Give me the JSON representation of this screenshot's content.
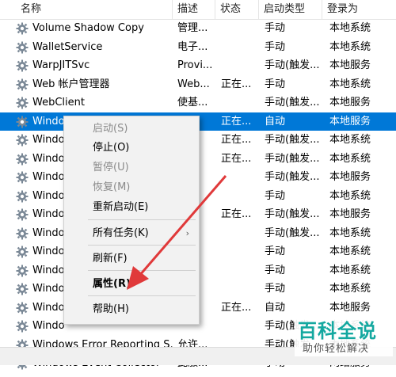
{
  "columns": {
    "name": "名称",
    "desc": "描述",
    "status": "状态",
    "type": "启动类型",
    "logon": "登录为"
  },
  "rows": [
    {
      "name": "Volume Shadow Copy",
      "desc": "管理...",
      "status": "",
      "type": "手动",
      "logon": "本地系统"
    },
    {
      "name": "WalletService",
      "desc": "电子...",
      "status": "",
      "type": "手动",
      "logon": "本地系统"
    },
    {
      "name": "WarpJITSvc",
      "desc": "Provi...",
      "status": "",
      "type": "手动(触发...",
      "logon": "本地服务"
    },
    {
      "name": "Web 帐户管理器",
      "desc": "Web...",
      "status": "正在...",
      "type": "手动",
      "logon": "本地系统"
    },
    {
      "name": "WebClient",
      "desc": "使基...",
      "status": "",
      "type": "手动(触发...",
      "logon": "本地服务"
    },
    {
      "name": "Windo",
      "desc": "...",
      "status": "正在...",
      "type": "自动",
      "logon": "本地服务",
      "selected": true
    },
    {
      "name": "Windo",
      "desc": "",
      "status": "正在...",
      "type": "手动(触发...",
      "logon": "本地系统"
    },
    {
      "name": "Windo",
      "desc": "",
      "status": "正在...",
      "type": "手动(触发...",
      "logon": "本地系统"
    },
    {
      "name": "Windo",
      "desc": "",
      "status": "",
      "type": "手动(触发...",
      "logon": "本地服务"
    },
    {
      "name": "Windo",
      "desc": "",
      "status": "",
      "type": "手动",
      "logon": "本地系统"
    },
    {
      "name": "Windo",
      "desc": "",
      "status": "正在...",
      "type": "手动(触发...",
      "logon": "本地服务"
    },
    {
      "name": "Windo",
      "desc": "",
      "status": "",
      "type": "手动(触发...",
      "logon": "本地系统"
    },
    {
      "name": "Windo",
      "desc": "",
      "status": "",
      "type": "手动",
      "logon": "本地系统"
    },
    {
      "name": "Windo",
      "desc": "",
      "status": "",
      "type": "手动",
      "logon": "本地系统"
    },
    {
      "name": "Windo",
      "desc": "",
      "status": "",
      "type": "手动",
      "logon": "本地系统"
    },
    {
      "name": "Windo",
      "desc": "",
      "status": "正在...",
      "type": "自动",
      "logon": "本地服务"
    },
    {
      "name": "Windo",
      "desc": "",
      "status": "",
      "type": "手动(触发...",
      "logon": "本地系统"
    },
    {
      "name": "Windows Error Reporting S...",
      "desc": "允许...",
      "status": "",
      "type": "手动(触发...",
      "logon": "本地系统"
    },
    {
      "name": "Windows Event Collector",
      "desc": "此服...",
      "status": "",
      "type": "手动",
      "logon": "网络服务"
    }
  ],
  "menu": {
    "start": "启动(S)",
    "stop": "停止(O)",
    "pause": "暂停(U)",
    "resume": "恢复(M)",
    "restart": "重新启动(E)",
    "all_tasks": "所有任务(K)",
    "submenu_arrow": "›",
    "refresh": "刷新(F)",
    "properties": "属性(R)",
    "help": "帮助(H)"
  },
  "watermark": {
    "main": "百科全说",
    "sub": "助你轻松解决"
  },
  "colors": {
    "selection": "#0078d7",
    "arrow": "#e0393a",
    "watermark": "#14a8a0"
  }
}
